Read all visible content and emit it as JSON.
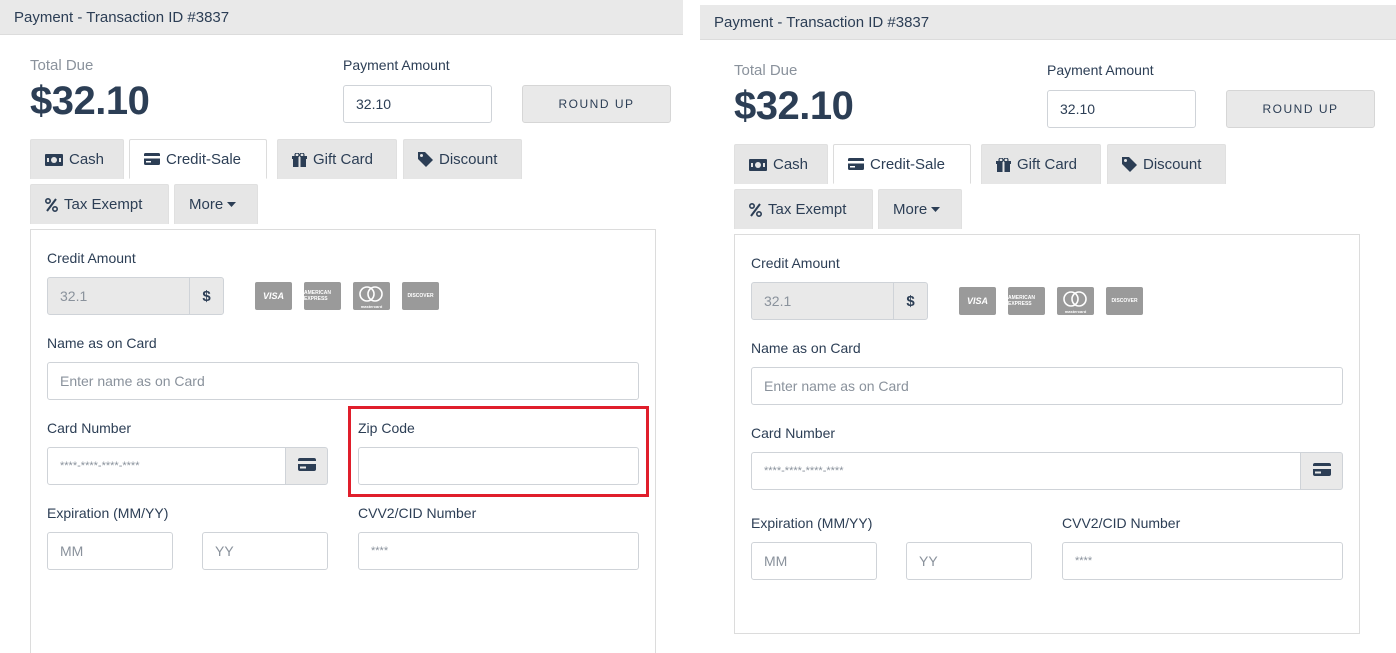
{
  "header": {
    "title": "Payment - Transaction ID #3837"
  },
  "summary": {
    "total_label": "Total Due",
    "total_value": "$32.10",
    "amount_label": "Payment Amount",
    "amount_value": "32.10",
    "round_up_label": "ROUND UP"
  },
  "tabs": [
    {
      "label": "Cash",
      "icon": "money-icon"
    },
    {
      "label": "Credit-Sale",
      "icon": "credit-card-icon",
      "active": true
    },
    {
      "label": "Gift Card",
      "icon": "gift-icon"
    },
    {
      "label": "Discount",
      "icon": "tag-icon"
    },
    {
      "label": "Tax Exempt",
      "icon": "percent-icon"
    },
    {
      "label": "More",
      "icon": "caret-down-icon"
    }
  ],
  "form": {
    "credit_amount_label": "Credit Amount",
    "credit_amount_value": "32.1",
    "currency_symbol": "$",
    "card_brands": [
      "VISA",
      "AMERICAN EXPRESS",
      "mastercard",
      "DISCOVER"
    ],
    "name_label": "Name as on Card",
    "name_placeholder": "Enter name as on Card",
    "card_number_label": "Card Number",
    "card_number_placeholder": "****-****-****-****",
    "zip_label": "Zip Code",
    "zip_value": "",
    "expiration_label": "Expiration (MM/YY)",
    "mm_placeholder": "MM",
    "yy_placeholder": "YY",
    "cvv_label": "CVV2/CID Number",
    "cvv_placeholder": "****"
  },
  "colors": {
    "highlight": "#e01e2b",
    "text": "#2c3e55",
    "muted": "#8a929c",
    "tab_bg": "#e6e6e6"
  }
}
